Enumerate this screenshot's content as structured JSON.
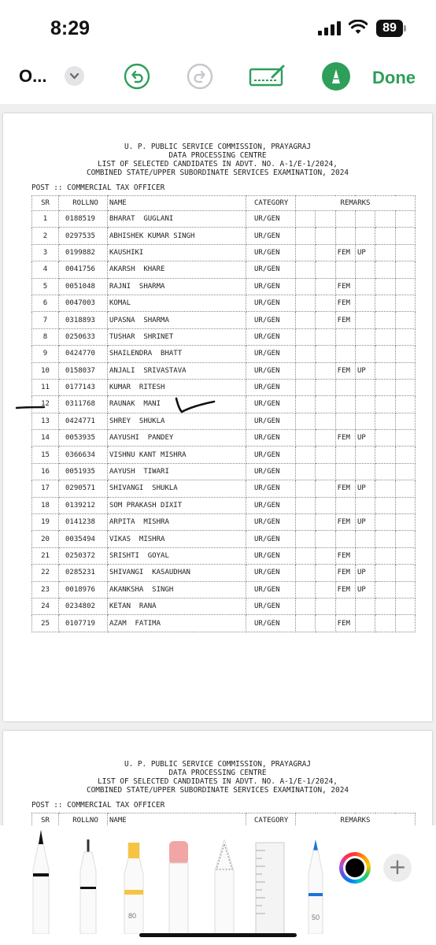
{
  "status_bar": {
    "time": "8:29",
    "battery": "89"
  },
  "toolbar": {
    "doc_title": "O...",
    "done_label": "Done"
  },
  "document": {
    "header_lines": [
      "U. P. PUBLIC SERVICE COMMISSION, PRAYAGRAJ",
      "DATA PROCESSING CENTRE",
      "LIST OF SELECTED CANDIDATES IN ADVT. NO. A-1/E-1/2024,",
      "COMBINED STATE/UPPER SUBORDINATE SERVICES EXAMINATION, 2024"
    ],
    "post": "POST :: COMMERCIAL TAX OFFICER",
    "columns": {
      "sr": "SR",
      "rollno": "ROLLNO",
      "name": "NAME",
      "category": "CATEGORY",
      "remarks": "REMARKS"
    },
    "rows": [
      {
        "sr": "1",
        "roll": "0188519",
        "name": "BHARAT  GUGLANI",
        "cat": "UR/GEN",
        "fem": "",
        "up": ""
      },
      {
        "sr": "2",
        "roll": "0297535",
        "name": "ABHISHEK KUMAR SINGH",
        "cat": "UR/GEN",
        "fem": "",
        "up": ""
      },
      {
        "sr": "3",
        "roll": "0199882",
        "name": "KAUSHIKI",
        "cat": "UR/GEN",
        "fem": "FEM",
        "up": "UP"
      },
      {
        "sr": "4",
        "roll": "0041756",
        "name": "AKARSH  KHARE",
        "cat": "UR/GEN",
        "fem": "",
        "up": ""
      },
      {
        "sr": "5",
        "roll": "0051048",
        "name": "RAJNI  SHARMA",
        "cat": "UR/GEN",
        "fem": "FEM",
        "up": ""
      },
      {
        "sr": "6",
        "roll": "0047003",
        "name": "KOMAL",
        "cat": "UR/GEN",
        "fem": "FEM",
        "up": ""
      },
      {
        "sr": "7",
        "roll": "0318893",
        "name": "UPASNA  SHARMA",
        "cat": "UR/GEN",
        "fem": "FEM",
        "up": ""
      },
      {
        "sr": "8",
        "roll": "0250633",
        "name": "TUSHAR  SHRINET",
        "cat": "UR/GEN",
        "fem": "",
        "up": ""
      },
      {
        "sr": "9",
        "roll": "0424770",
        "name": "SHAILENDRA  BHATT",
        "cat": "UR/GEN",
        "fem": "",
        "up": ""
      },
      {
        "sr": "10",
        "roll": "0158037",
        "name": "ANJALI  SRIVASTAVA",
        "cat": "UR/GEN",
        "fem": "FEM",
        "up": "UP"
      },
      {
        "sr": "11",
        "roll": "0177143",
        "name": "KUMAR  RITESH",
        "cat": "UR/GEN",
        "fem": "",
        "up": ""
      },
      {
        "sr": "12",
        "roll": "0311768",
        "name": "RAUNAK  MANI",
        "cat": "UR/GEN",
        "fem": "",
        "up": ""
      },
      {
        "sr": "13",
        "roll": "0424771",
        "name": "SHREY  SHUKLA",
        "cat": "UR/GEN",
        "fem": "",
        "up": ""
      },
      {
        "sr": "14",
        "roll": "0053935",
        "name": "AAYUSHI  PANDEY",
        "cat": "UR/GEN",
        "fem": "FEM",
        "up": "UP"
      },
      {
        "sr": "15",
        "roll": "0366634",
        "name": "VISHNU KANT MISHRA",
        "cat": "UR/GEN",
        "fem": "",
        "up": ""
      },
      {
        "sr": "16",
        "roll": "0051935",
        "name": "AAYUSH  TIWARI",
        "cat": "UR/GEN",
        "fem": "",
        "up": ""
      },
      {
        "sr": "17",
        "roll": "0290571",
        "name": "SHIVANGI  SHUKLA",
        "cat": "UR/GEN",
        "fem": "FEM",
        "up": "UP"
      },
      {
        "sr": "18",
        "roll": "0139212",
        "name": "SOM PRAKASH DIXIT",
        "cat": "UR/GEN",
        "fem": "",
        "up": ""
      },
      {
        "sr": "19",
        "roll": "0141238",
        "name": "ARPITA  MISHRA",
        "cat": "UR/GEN",
        "fem": "FEM",
        "up": "UP"
      },
      {
        "sr": "20",
        "roll": "0035494",
        "name": "VIKAS  MISHRA",
        "cat": "UR/GEN",
        "fem": "",
        "up": ""
      },
      {
        "sr": "21",
        "roll": "0250372",
        "name": "SRISHTI  GOYAL",
        "cat": "UR/GEN",
        "fem": "FEM",
        "up": ""
      },
      {
        "sr": "22",
        "roll": "0285231",
        "name": "SHIVANGI  KASAUDHAN",
        "cat": "UR/GEN",
        "fem": "FEM",
        "up": "UP"
      },
      {
        "sr": "23",
        "roll": "0018976",
        "name": "AKANKSHA  SINGH",
        "cat": "UR/GEN",
        "fem": "FEM",
        "up": "UP"
      },
      {
        "sr": "24",
        "roll": "0234802",
        "name": "KETAN  RANA",
        "cat": "UR/GEN",
        "fem": "",
        "up": ""
      },
      {
        "sr": "25",
        "roll": "0107719",
        "name": "AZAM  FATIMA",
        "cat": "UR/GEN",
        "fem": "FEM",
        "up": ""
      }
    ]
  },
  "palette": {
    "tools": [
      "pen",
      "fineliner",
      "highlighter",
      "eraser",
      "lasso",
      "ruler",
      "pencil"
    ],
    "highlighter_size": "80",
    "pencil_size": "50",
    "selected_color": "#000000",
    "accent_color": "#2e9e5b"
  }
}
